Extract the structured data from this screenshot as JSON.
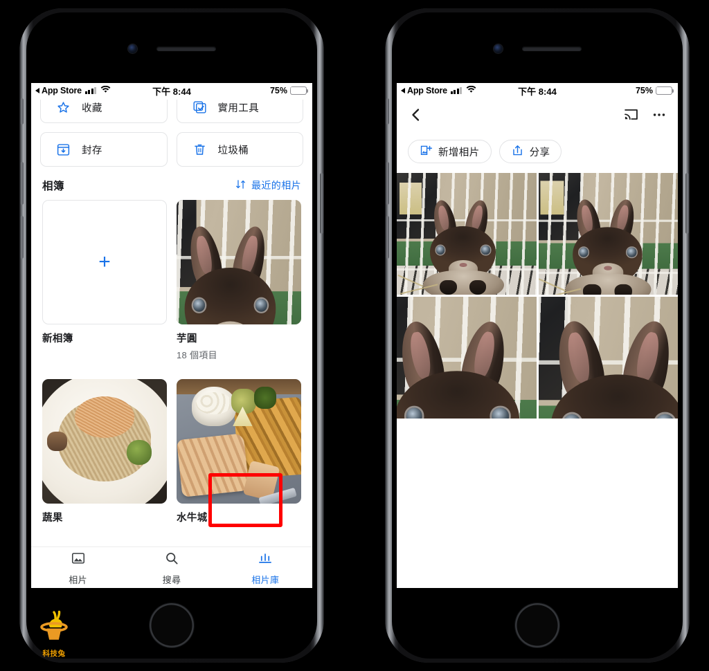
{
  "watermark": {
    "label": "科技兔",
    "icon": "rabbit-in-hat-logo",
    "color": "#f0a000"
  },
  "status_bar": {
    "back_label": "App Store",
    "signal_icon": "cellular-bars-icon",
    "wifi_icon": "wifi-icon",
    "time": "下午 8:44",
    "battery_percent": "75%",
    "battery_icon": "battery-charging-icon"
  },
  "left_phone": {
    "utility_buttons": [
      {
        "label": "收藏",
        "icon": "star-outline-icon",
        "clipped": true
      },
      {
        "label": "實用工具",
        "icon": "checkbox-stack-icon",
        "clipped": true
      },
      {
        "label": "封存",
        "icon": "archive-box-icon",
        "clipped": false
      },
      {
        "label": "垃圾桶",
        "icon": "trash-can-icon",
        "clipped": false
      }
    ],
    "albums_section": {
      "title": "相簿",
      "sort_label": "最近的相片",
      "sort_icon": "sort-arrows-icon"
    },
    "albums": [
      {
        "name": "新相簿",
        "count": "",
        "thumb": "new-album-plus",
        "icon": "plus-icon"
      },
      {
        "name": "芋圓",
        "count": "18 個項目",
        "thumb": "rabbit-photo"
      },
      {
        "name": "蔬果",
        "count": "",
        "thumb": "pasta-photo"
      },
      {
        "name": "水牛城",
        "count": "",
        "thumb": "salmon-fries-photo"
      }
    ],
    "tabs": [
      {
        "label": "相片",
        "icon": "photo-icon",
        "active": false
      },
      {
        "label": "搜尋",
        "icon": "search-icon",
        "active": false
      },
      {
        "label": "相片庫",
        "icon": "photo-library-icon",
        "active": true
      }
    ],
    "highlight": {
      "target": "相片庫",
      "color": "#ff0000"
    }
  },
  "right_phone": {
    "toolbar": {
      "back_icon": "chevron-left-icon",
      "cast_icon": "cast-icon",
      "more_icon": "more-horizontal-icon"
    },
    "action_chips": [
      {
        "label": "新增相片",
        "icon": "add-photo-icon"
      },
      {
        "label": "分享",
        "icon": "share-icon"
      }
    ],
    "photos": [
      {
        "name": "rabbit-photo-1"
      },
      {
        "name": "rabbit-photo-2"
      },
      {
        "name": "rabbit-photo-3"
      },
      {
        "name": "rabbit-photo-4"
      }
    ]
  },
  "accent_color": "#1a73e8",
  "text_color": "#202124",
  "muted_text_color": "#5f6368"
}
